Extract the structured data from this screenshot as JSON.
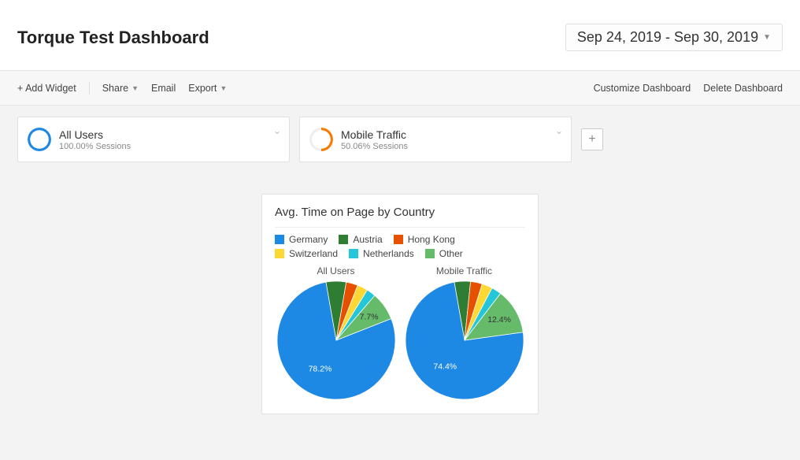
{
  "header": {
    "title": "Torque Test Dashboard",
    "date_range": "Sep 24, 2019 - Sep 30, 2019"
  },
  "toolbar": {
    "add_widget": "+ Add Widget",
    "share": "Share",
    "email": "Email",
    "export": "Export",
    "customize": "Customize Dashboard",
    "delete": "Delete Dashboard"
  },
  "segments": [
    {
      "name": "All Users",
      "sub": "100.00% Sessions",
      "ring_color": "#1e88e5",
      "fill": 1.0
    },
    {
      "name": "Mobile Traffic",
      "sub": "50.06% Sessions",
      "ring_color": "#f57c00",
      "fill": 0.5
    }
  ],
  "widget": {
    "title": "Avg. Time on Page by Country"
  },
  "legend": [
    {
      "label": "Germany",
      "color": "#1e88e5"
    },
    {
      "label": "Austria",
      "color": "#2e7d32"
    },
    {
      "label": "Hong Kong",
      "color": "#e65100"
    },
    {
      "label": "Switzerland",
      "color": "#fdd835"
    },
    {
      "label": "Netherlands",
      "color": "#26c6da"
    },
    {
      "label": "Other",
      "color": "#66bb6a"
    }
  ],
  "chart_data": {
    "type": "pie",
    "series": [
      {
        "name": "All Users",
        "slices": [
          {
            "label": "Germany",
            "value": 78.2,
            "show_label": "78.2%"
          },
          {
            "label": "Austria",
            "value": 5.5
          },
          {
            "label": "Hong Kong",
            "value": 3.2
          },
          {
            "label": "Switzerland",
            "value": 2.9
          },
          {
            "label": "Netherlands",
            "value": 2.5
          },
          {
            "label": "Other",
            "value": 7.7,
            "show_label": "7.7%"
          }
        ]
      },
      {
        "name": "Mobile Traffic",
        "slices": [
          {
            "label": "Germany",
            "value": 74.4,
            "show_label": "74.4%"
          },
          {
            "label": "Austria",
            "value": 4.4
          },
          {
            "label": "Hong Kong",
            "value": 3.2
          },
          {
            "label": "Switzerland",
            "value": 2.9
          },
          {
            "label": "Netherlands",
            "value": 2.7
          },
          {
            "label": "Other",
            "value": 12.4,
            "show_label": "12.4%"
          }
        ]
      }
    ]
  }
}
